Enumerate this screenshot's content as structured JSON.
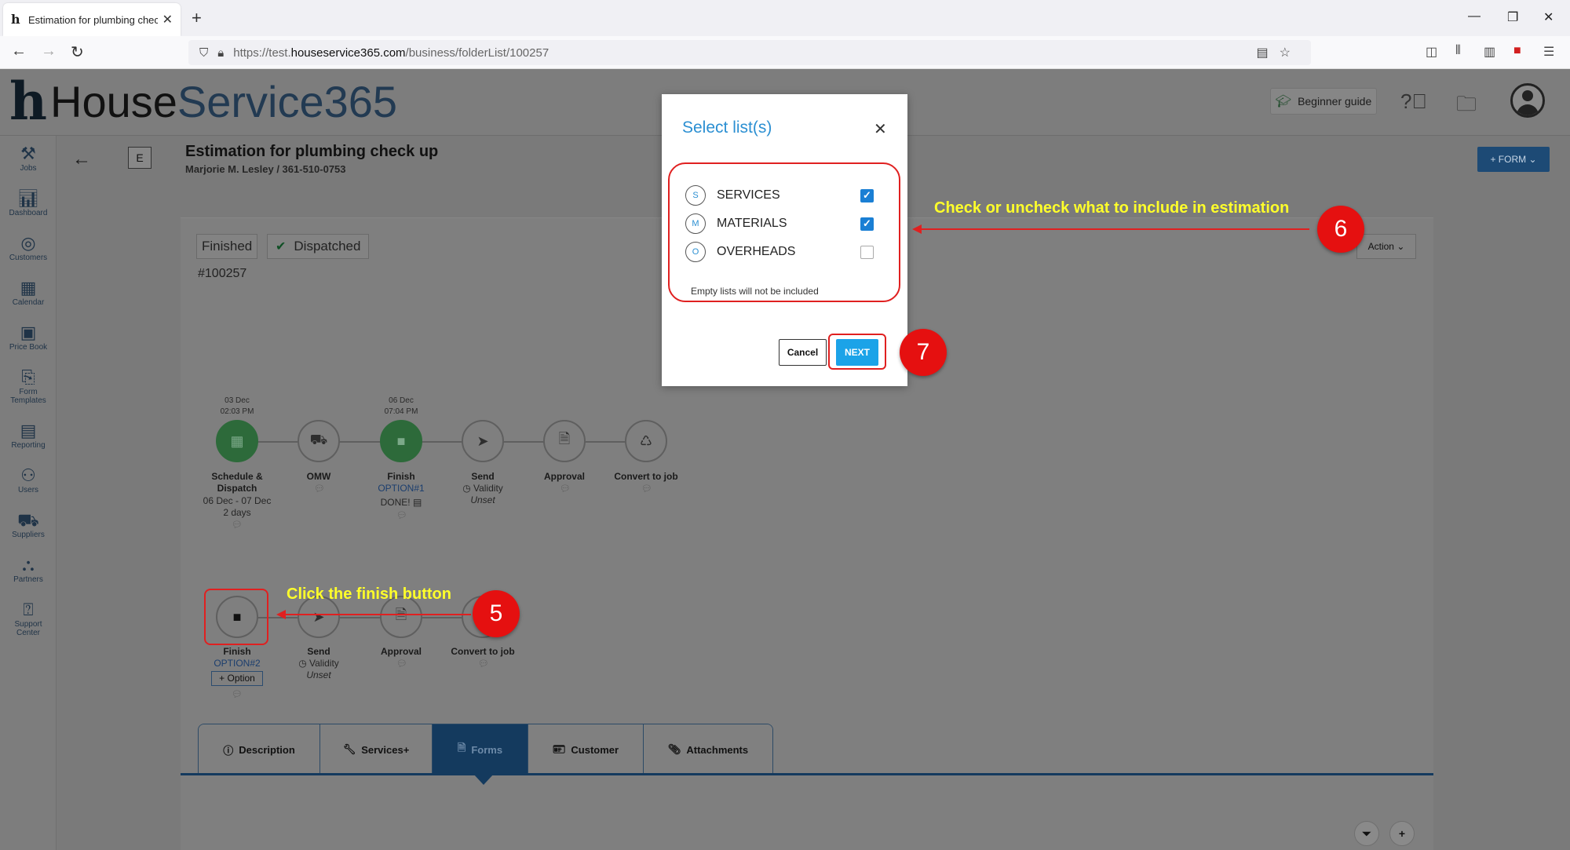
{
  "browser": {
    "tab_title": "Estimation for plumbing check",
    "url_prefix": "https://test.",
    "url_host": "houseservice365.com",
    "url_path": "/business/folderList/100257"
  },
  "header": {
    "logo_house": "House",
    "logo_service": "Service365",
    "beginner_guide": "Beginner guide"
  },
  "sidebar": {
    "items": [
      {
        "label": "Jobs",
        "icon": "tools-icon"
      },
      {
        "label": "Dashboard",
        "icon": "chart-icon"
      },
      {
        "label": "Customers",
        "icon": "target-icon"
      },
      {
        "label": "Calendar",
        "icon": "calendar-icon"
      },
      {
        "label": "Price Book",
        "icon": "price-tag-icon"
      },
      {
        "label": "Form",
        "label2": "Templates",
        "icon": "form-icon"
      },
      {
        "label": "Reporting",
        "icon": "report-icon"
      },
      {
        "label": "Users",
        "icon": "users-icon"
      },
      {
        "label": "Suppliers",
        "icon": "truck-icon"
      },
      {
        "label": "Partners",
        "icon": "partners-icon"
      },
      {
        "label": "Support",
        "label2": "Center",
        "icon": "help-icon"
      }
    ]
  },
  "page": {
    "type_letter": "E",
    "title": "Estimation for plumbing check up",
    "subtitle": "Marjorie M. Lesley / 361-510-0753",
    "form_button": "+ FORM",
    "status_finished": "Finished",
    "status_dispatched": "Dispatched",
    "job_id": "#100257",
    "action_button": "Action"
  },
  "timeline1": {
    "schedule": {
      "date": "03 Dec",
      "time": "02:03 PM",
      "label1": "Schedule &",
      "label2": "Dispatch",
      "range": "06 Dec - 07 Dec",
      "duration": "2 days"
    },
    "omw": {
      "label": "OMW"
    },
    "finish": {
      "date": "06 Dec",
      "time": "07:04 PM",
      "label": "Finish",
      "option": "OPTION#1",
      "status": "DONE!"
    },
    "send": {
      "label": "Send",
      "validity": "Validity",
      "unset": "Unset"
    },
    "approval": {
      "label": "Approval"
    },
    "convert": {
      "label": "Convert to job"
    }
  },
  "timeline2": {
    "finish": {
      "label": "Finish",
      "option": "OPTION#2",
      "add_option": "+ Option"
    },
    "send": {
      "label": "Send",
      "validity": "Validity",
      "unset": "Unset"
    },
    "approval": {
      "label": "Approval"
    },
    "convert": {
      "label": "Convert to job"
    }
  },
  "tabs": [
    {
      "label": "Description",
      "icon": "info-icon"
    },
    {
      "label": "Services+",
      "icon": "wrench-icon"
    },
    {
      "label": "Forms",
      "icon": "document-icon"
    },
    {
      "label": "Customer",
      "icon": "id-card-icon"
    },
    {
      "label": "Attachments",
      "icon": "paperclip-icon"
    }
  ],
  "modal": {
    "title": "Select list(s)",
    "options": [
      {
        "letter": "S",
        "label": "SERVICES",
        "checked": true
      },
      {
        "letter": "M",
        "label": "MATERIALS",
        "checked": true
      },
      {
        "letter": "O",
        "label": "OVERHEADS",
        "checked": false
      }
    ],
    "note": "Empty lists will not be included",
    "cancel": "Cancel",
    "next": "NEXT"
  },
  "annotations": {
    "step5_number": "5",
    "step5_text": "Click the finish button",
    "step6_number": "6",
    "step6_text": "Check or uncheck what to include in estimation",
    "step7_number": "7"
  },
  "colors": {
    "annotation_red": "#e02020",
    "annotation_yellow": "#ffff2a",
    "brand_blue": "#2b8fd2",
    "next_blue": "#1ba3e8"
  }
}
